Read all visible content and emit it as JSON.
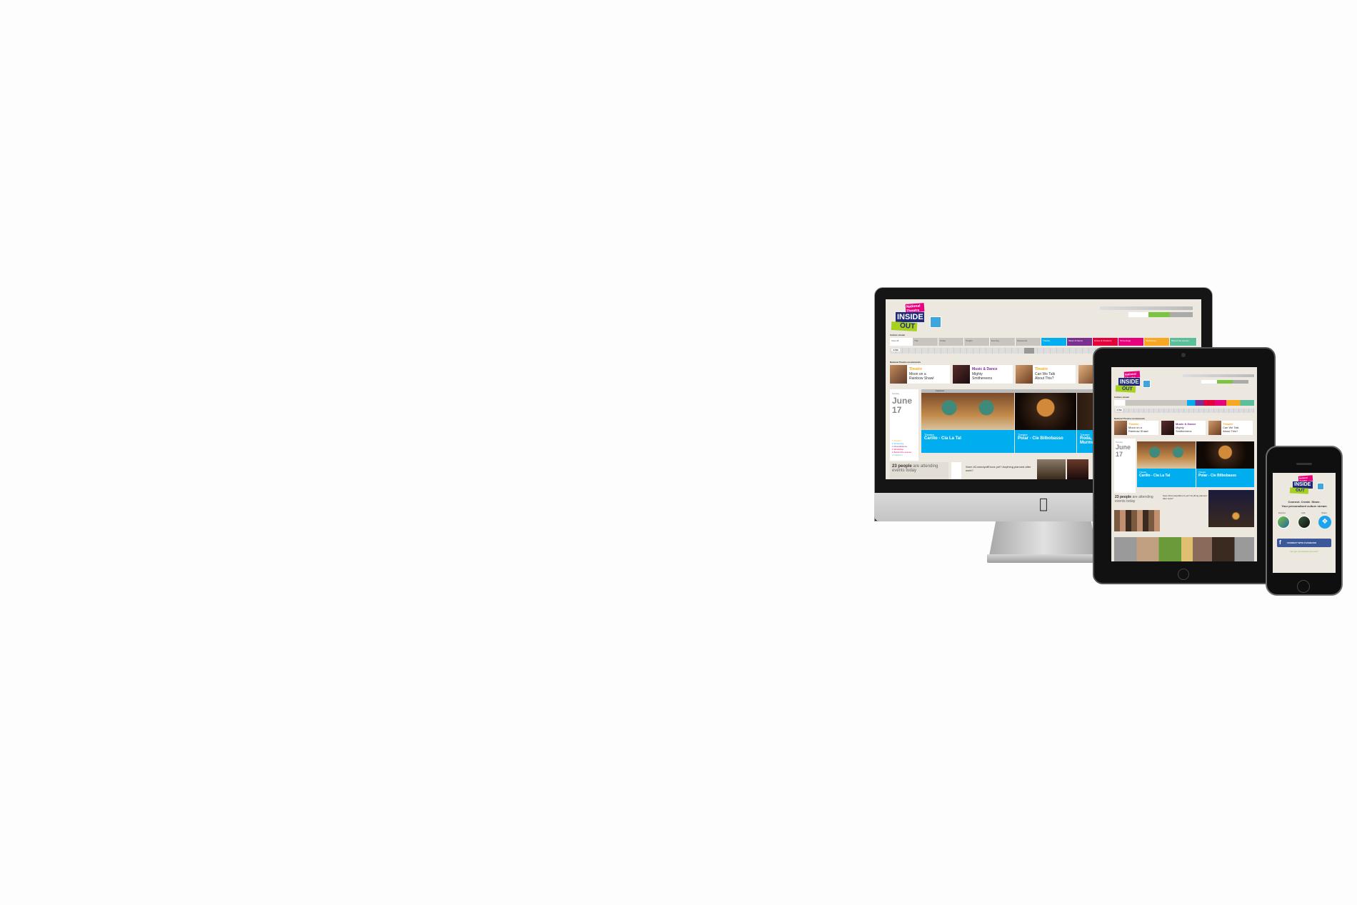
{
  "colors": {
    "background": "#fdfdfd",
    "site_bg": "#ece7df",
    "theatre": "#00aeef",
    "music_dance": "#7b2f8e",
    "circus": "#e4003a",
    "screenings": "#e6007e",
    "workshops": "#f7a823",
    "behind_scenes": "#5bbf9b",
    "accent_green": "#7cc243"
  },
  "logo": {
    "line1": "National Theatre",
    "line2": "INSIDE",
    "line3": "OUT"
  },
  "header": {
    "culture_stream": "Culture stream",
    "tabs": [
      "View all",
      "This",
      "Today",
      "Tonight",
      "Evening",
      "Weekends",
      "Theatre",
      "Music & Dance",
      "Circus & Outdoors",
      "Screenings",
      "Workshops",
      "Behind the scenes"
    ],
    "month": "JUNE",
    "day_short": "17",
    "recommends": "National Theatre recommends"
  },
  "recommendations": [
    {
      "category": "Theatre",
      "title": "Moon on a\nRainbow Shawl"
    },
    {
      "category": "Music & Dance",
      "title": "Mighty\nSmithereens"
    },
    {
      "category": "Theatre",
      "title": "Can We Talk\nAbout This?"
    }
  ],
  "date_panel": {
    "weekday": "Sunday",
    "month": "June",
    "day": "17",
    "featured": "Featured",
    "legend": [
      "1 Theatre",
      "1 Screening",
      "1 Music&Dance",
      "1 Workshop",
      "1 Behind the scenes",
      "2 Outdoors"
    ]
  },
  "events": [
    {
      "category": "Theatre",
      "title": "Carillo - Cia La Tal"
    },
    {
      "category": "Theatre",
      "title": "Polar - Cie Bilbobasso"
    },
    {
      "category": "Theatre",
      "title": "Roda, Mu Murmu"
    }
  ],
  "attending": {
    "count": "23 people",
    "text": "are attending events today",
    "tweet": "Seen #ComedyofErrors yet? Anything planned after work?"
  },
  "mobile": {
    "tagline1": "Connect. Create. Share.",
    "tagline2": "Your personalised culture stream",
    "icons": [
      "Explore",
      "Add",
      "Share"
    ],
    "facebook": "CONNECT WITH FACEBOOK",
    "alt_link": "Not got a Facebook account?"
  }
}
